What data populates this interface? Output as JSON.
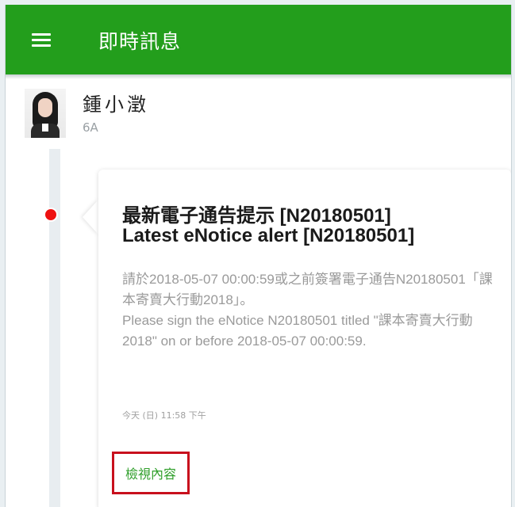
{
  "app_bar": {
    "title": "即時訊息",
    "menu_icon": "hamburger-menu-icon",
    "color": "#239e1c"
  },
  "sender": {
    "name": "鍾小澂",
    "class": "6A"
  },
  "message": {
    "title_zh": "最新電子通告提示 [N20180501]",
    "title_en": "Latest eNotice alert [N20180501]",
    "body_zh": "請於2018-05-07 00:00:59或之前簽署電子通告N20180501「課本寄賣大行動2018」。",
    "body_en": "Please sign the eNotice N20180501 titled \"課本寄賣大行動2018\" on or before 2018-05-07 00:00:59.",
    "time": "今天 (日) 11:58 下午",
    "view_link": "檢視內容",
    "link_color": "#2f9f2a",
    "unread_indicator_color": "#ee1111"
  }
}
